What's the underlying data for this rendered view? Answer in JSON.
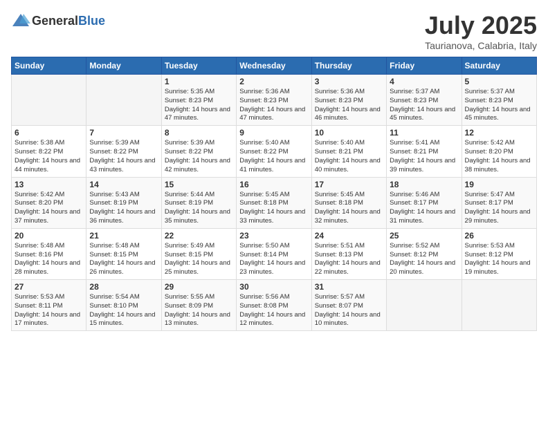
{
  "header": {
    "logo_general": "General",
    "logo_blue": "Blue",
    "month_title": "July 2025",
    "subtitle": "Taurianova, Calabria, Italy"
  },
  "days_of_week": [
    "Sunday",
    "Monday",
    "Tuesday",
    "Wednesday",
    "Thursday",
    "Friday",
    "Saturday"
  ],
  "weeks": [
    [
      {
        "day": "",
        "sunrise": "",
        "sunset": "",
        "daylight": ""
      },
      {
        "day": "",
        "sunrise": "",
        "sunset": "",
        "daylight": ""
      },
      {
        "day": "1",
        "sunrise": "Sunrise: 5:35 AM",
        "sunset": "Sunset: 8:23 PM",
        "daylight": "Daylight: 14 hours and 47 minutes."
      },
      {
        "day": "2",
        "sunrise": "Sunrise: 5:36 AM",
        "sunset": "Sunset: 8:23 PM",
        "daylight": "Daylight: 14 hours and 47 minutes."
      },
      {
        "day": "3",
        "sunrise": "Sunrise: 5:36 AM",
        "sunset": "Sunset: 8:23 PM",
        "daylight": "Daylight: 14 hours and 46 minutes."
      },
      {
        "day": "4",
        "sunrise": "Sunrise: 5:37 AM",
        "sunset": "Sunset: 8:23 PM",
        "daylight": "Daylight: 14 hours and 45 minutes."
      },
      {
        "day": "5",
        "sunrise": "Sunrise: 5:37 AM",
        "sunset": "Sunset: 8:23 PM",
        "daylight": "Daylight: 14 hours and 45 minutes."
      }
    ],
    [
      {
        "day": "6",
        "sunrise": "Sunrise: 5:38 AM",
        "sunset": "Sunset: 8:22 PM",
        "daylight": "Daylight: 14 hours and 44 minutes."
      },
      {
        "day": "7",
        "sunrise": "Sunrise: 5:39 AM",
        "sunset": "Sunset: 8:22 PM",
        "daylight": "Daylight: 14 hours and 43 minutes."
      },
      {
        "day": "8",
        "sunrise": "Sunrise: 5:39 AM",
        "sunset": "Sunset: 8:22 PM",
        "daylight": "Daylight: 14 hours and 42 minutes."
      },
      {
        "day": "9",
        "sunrise": "Sunrise: 5:40 AM",
        "sunset": "Sunset: 8:22 PM",
        "daylight": "Daylight: 14 hours and 41 minutes."
      },
      {
        "day": "10",
        "sunrise": "Sunrise: 5:40 AM",
        "sunset": "Sunset: 8:21 PM",
        "daylight": "Daylight: 14 hours and 40 minutes."
      },
      {
        "day": "11",
        "sunrise": "Sunrise: 5:41 AM",
        "sunset": "Sunset: 8:21 PM",
        "daylight": "Daylight: 14 hours and 39 minutes."
      },
      {
        "day": "12",
        "sunrise": "Sunrise: 5:42 AM",
        "sunset": "Sunset: 8:20 PM",
        "daylight": "Daylight: 14 hours and 38 minutes."
      }
    ],
    [
      {
        "day": "13",
        "sunrise": "Sunrise: 5:42 AM",
        "sunset": "Sunset: 8:20 PM",
        "daylight": "Daylight: 14 hours and 37 minutes."
      },
      {
        "day": "14",
        "sunrise": "Sunrise: 5:43 AM",
        "sunset": "Sunset: 8:19 PM",
        "daylight": "Daylight: 14 hours and 36 minutes."
      },
      {
        "day": "15",
        "sunrise": "Sunrise: 5:44 AM",
        "sunset": "Sunset: 8:19 PM",
        "daylight": "Daylight: 14 hours and 35 minutes."
      },
      {
        "day": "16",
        "sunrise": "Sunrise: 5:45 AM",
        "sunset": "Sunset: 8:18 PM",
        "daylight": "Daylight: 14 hours and 33 minutes."
      },
      {
        "day": "17",
        "sunrise": "Sunrise: 5:45 AM",
        "sunset": "Sunset: 8:18 PM",
        "daylight": "Daylight: 14 hours and 32 minutes."
      },
      {
        "day": "18",
        "sunrise": "Sunrise: 5:46 AM",
        "sunset": "Sunset: 8:17 PM",
        "daylight": "Daylight: 14 hours and 31 minutes."
      },
      {
        "day": "19",
        "sunrise": "Sunrise: 5:47 AM",
        "sunset": "Sunset: 8:17 PM",
        "daylight": "Daylight: 14 hours and 29 minutes."
      }
    ],
    [
      {
        "day": "20",
        "sunrise": "Sunrise: 5:48 AM",
        "sunset": "Sunset: 8:16 PM",
        "daylight": "Daylight: 14 hours and 28 minutes."
      },
      {
        "day": "21",
        "sunrise": "Sunrise: 5:48 AM",
        "sunset": "Sunset: 8:15 PM",
        "daylight": "Daylight: 14 hours and 26 minutes."
      },
      {
        "day": "22",
        "sunrise": "Sunrise: 5:49 AM",
        "sunset": "Sunset: 8:15 PM",
        "daylight": "Daylight: 14 hours and 25 minutes."
      },
      {
        "day": "23",
        "sunrise": "Sunrise: 5:50 AM",
        "sunset": "Sunset: 8:14 PM",
        "daylight": "Daylight: 14 hours and 23 minutes."
      },
      {
        "day": "24",
        "sunrise": "Sunrise: 5:51 AM",
        "sunset": "Sunset: 8:13 PM",
        "daylight": "Daylight: 14 hours and 22 minutes."
      },
      {
        "day": "25",
        "sunrise": "Sunrise: 5:52 AM",
        "sunset": "Sunset: 8:12 PM",
        "daylight": "Daylight: 14 hours and 20 minutes."
      },
      {
        "day": "26",
        "sunrise": "Sunrise: 5:53 AM",
        "sunset": "Sunset: 8:12 PM",
        "daylight": "Daylight: 14 hours and 19 minutes."
      }
    ],
    [
      {
        "day": "27",
        "sunrise": "Sunrise: 5:53 AM",
        "sunset": "Sunset: 8:11 PM",
        "daylight": "Daylight: 14 hours and 17 minutes."
      },
      {
        "day": "28",
        "sunrise": "Sunrise: 5:54 AM",
        "sunset": "Sunset: 8:10 PM",
        "daylight": "Daylight: 14 hours and 15 minutes."
      },
      {
        "day": "29",
        "sunrise": "Sunrise: 5:55 AM",
        "sunset": "Sunset: 8:09 PM",
        "daylight": "Daylight: 14 hours and 13 minutes."
      },
      {
        "day": "30",
        "sunrise": "Sunrise: 5:56 AM",
        "sunset": "Sunset: 8:08 PM",
        "daylight": "Daylight: 14 hours and 12 minutes."
      },
      {
        "day": "31",
        "sunrise": "Sunrise: 5:57 AM",
        "sunset": "Sunset: 8:07 PM",
        "daylight": "Daylight: 14 hours and 10 minutes."
      },
      {
        "day": "",
        "sunrise": "",
        "sunset": "",
        "daylight": ""
      },
      {
        "day": "",
        "sunrise": "",
        "sunset": "",
        "daylight": ""
      }
    ]
  ]
}
